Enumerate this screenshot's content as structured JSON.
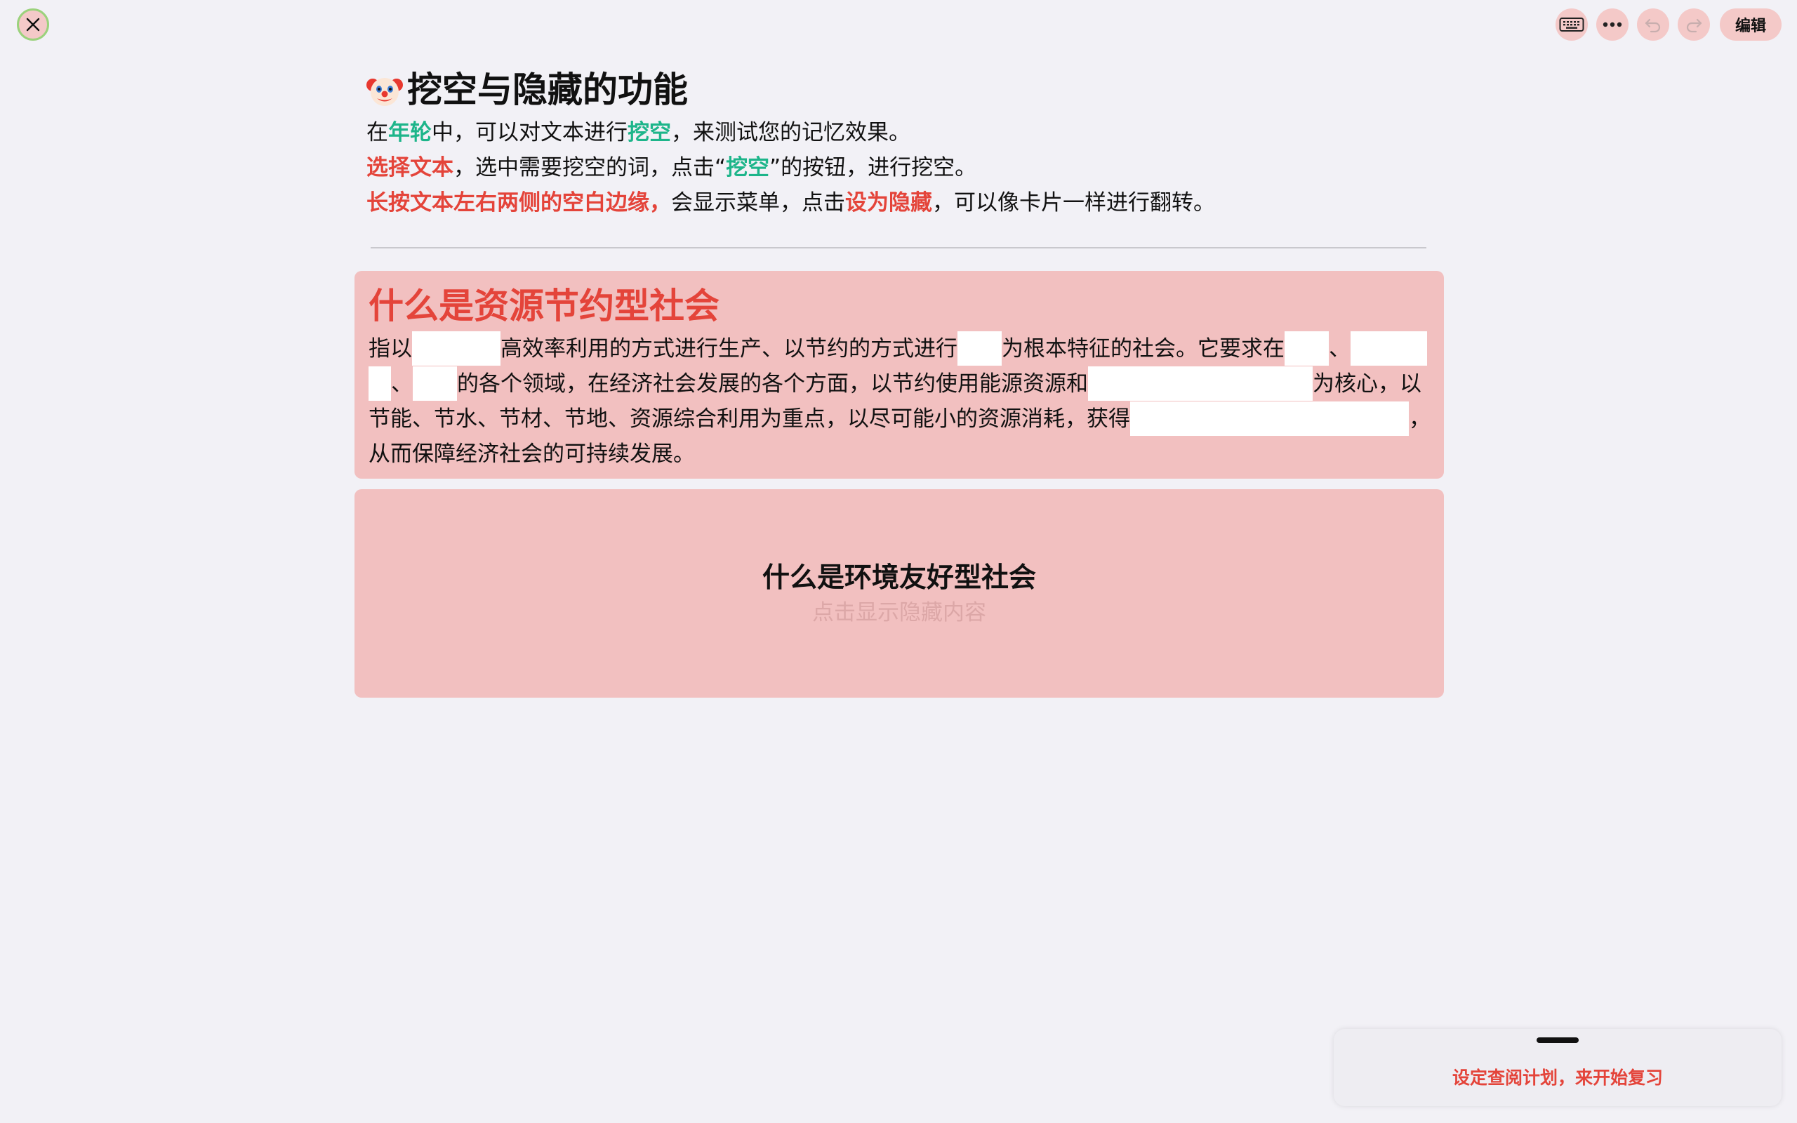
{
  "toolbar": {
    "edit_label": "编辑"
  },
  "intro": {
    "title": "挖空与隐藏的功能",
    "line1": {
      "p1": "在",
      "app_name": "年轮",
      "p2": "中，可以对文本进行",
      "keyword": "挖空",
      "p3": "，来测试您的记忆效果。"
    },
    "line2": {
      "select_text": "选择文本",
      "p1": "，选中需要挖空的词，点击“",
      "keyword": "挖空",
      "p2": "”的按钮，进行挖空。"
    },
    "line3": {
      "long_press": "长按文本左右两侧的空白边缘，",
      "p1": "会显示菜单，点击",
      "set_hidden": "设为隐藏",
      "p2": "，可以像卡片一样进行翻转。"
    }
  },
  "card1": {
    "title": "什么是资源节约型社会",
    "t1": "指以",
    "t2": "高效率利用的方式进行生产、以节约的方式进行",
    "t3": "为根本特征的社会。它要求在",
    "t4": "、",
    "t5": "、",
    "t6": "的各个领域，在经济社会发展的各个方面，以节约使用能源资源和",
    "t7": "为核心，以节能、节水、节材、节地、资源综合利用为重点，以尽可能小的资源消耗，获得",
    "t8": "，从而保障经济社会的可持续发展。"
  },
  "card2": {
    "title": "什么是环境友好型社会",
    "hint": "点击显示隐藏内容"
  },
  "bottom_sheet": {
    "action": "设定查阅计划，来开始复习"
  },
  "colors": {
    "background": "#F2F1F6",
    "card": "#F2C0C0",
    "accent_red": "#E4443A",
    "accent_green": "#1DB58A",
    "button_bg": "#F4C9C8"
  },
  "icons": [
    "close-icon",
    "keyboard-icon",
    "more-icon",
    "undo-icon",
    "redo-icon",
    "clown-emoji-icon"
  ]
}
